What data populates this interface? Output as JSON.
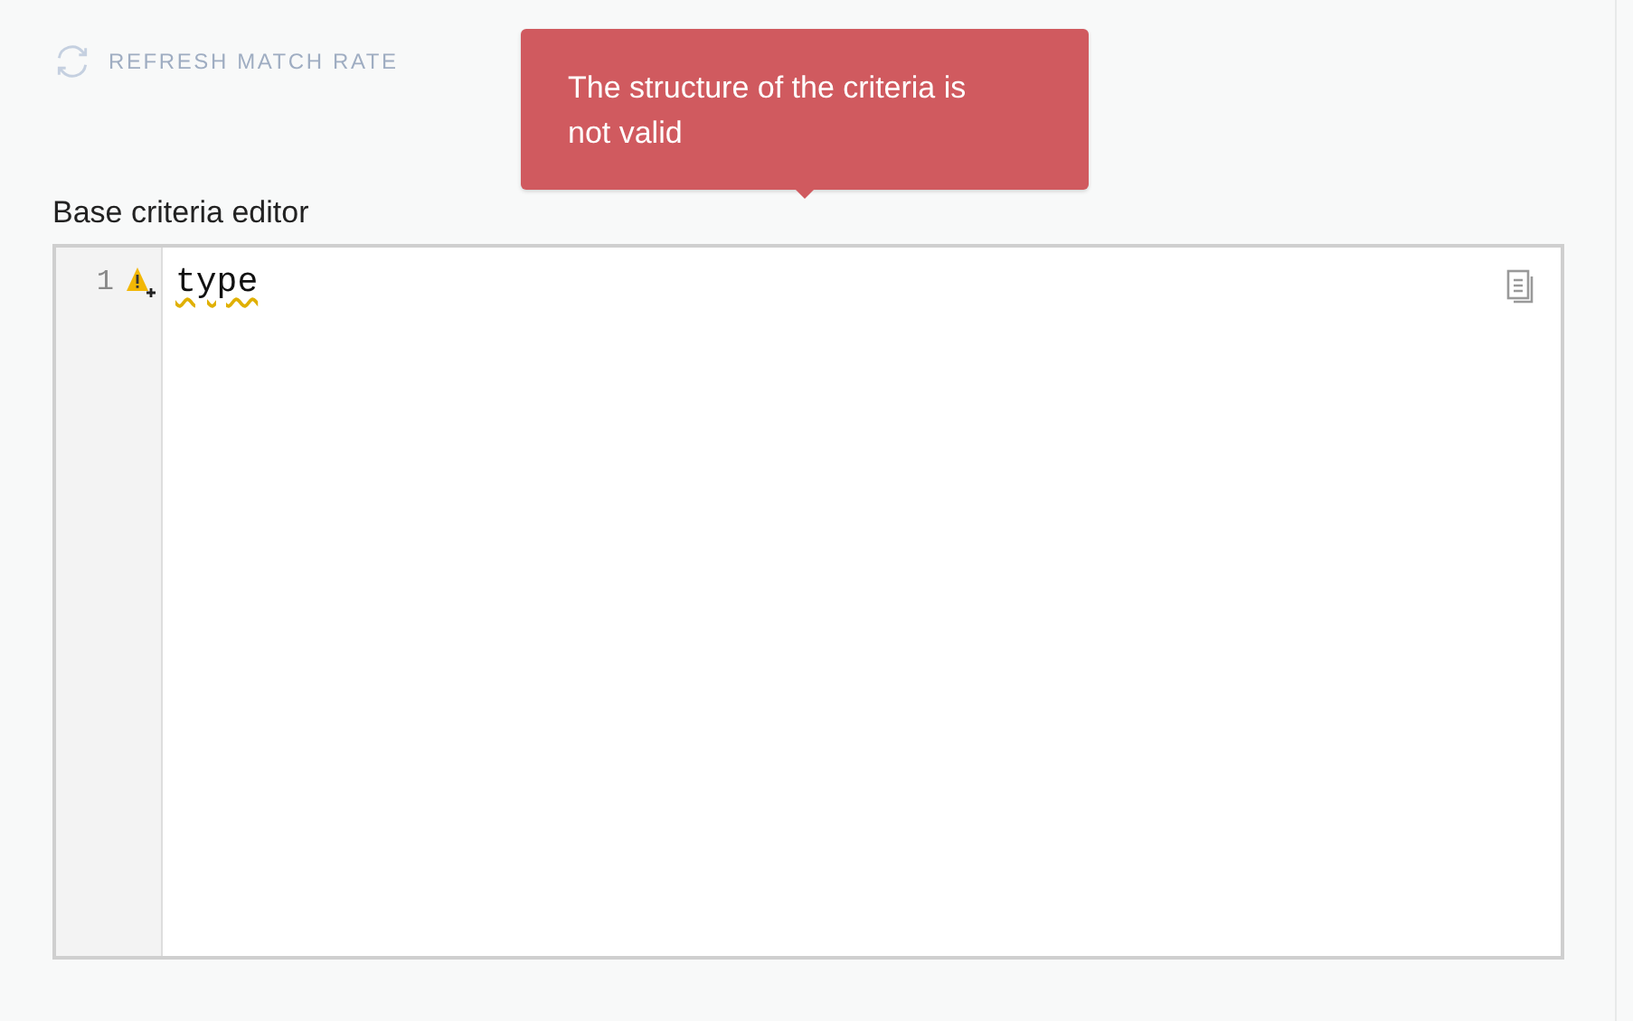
{
  "refresh_button": {
    "label": "REFRESH MATCH RATE",
    "disabled": true
  },
  "tooltip": {
    "text": "The structure of the criteria is not valid"
  },
  "editor": {
    "label": "Base criteria editor",
    "lines": [
      {
        "number": "1",
        "text": "type",
        "warning": true
      }
    ]
  }
}
